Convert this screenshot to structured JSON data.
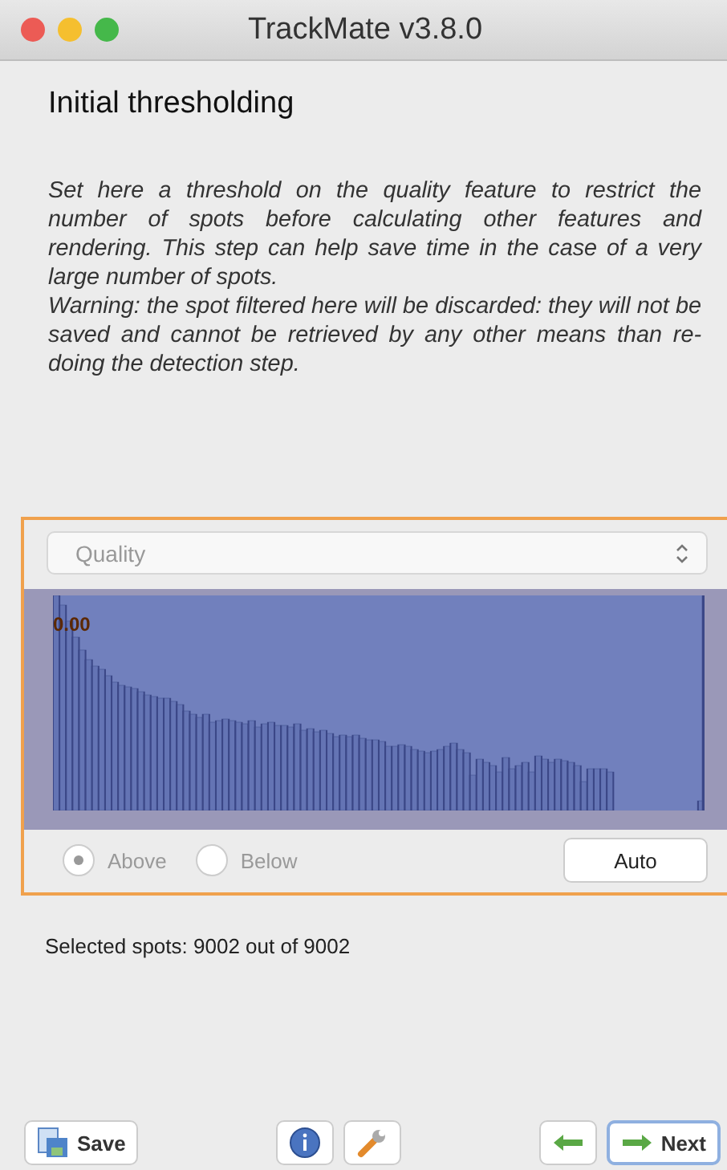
{
  "window": {
    "title": "TrackMate v3.8.0"
  },
  "heading": "Initial thresholding",
  "description": [
    "Set here a threshold on the quality feature to restrict the number of spots before calculating other features and rendering. This step can help save time in the case of a very large number of spots.",
    "Warning: the spot filtered here will be discarded: they will not be saved and cannot be retrieved by any other means than re-doing the detection step."
  ],
  "threshold_panel": {
    "feature": "Quality",
    "threshold_label": "0.00",
    "options": [
      {
        "label": "Above",
        "selected": true
      },
      {
        "label": "Below",
        "selected": false
      }
    ],
    "auto_button": "Auto"
  },
  "selected_spots": "Selected spots: 9002 out of 9002",
  "buttons": [
    {
      "kind": "save",
      "label": "Save"
    },
    {
      "kind": "info"
    },
    {
      "kind": "settings"
    },
    {
      "kind": "back"
    },
    {
      "kind": "next",
      "label": "Next"
    }
  ]
}
